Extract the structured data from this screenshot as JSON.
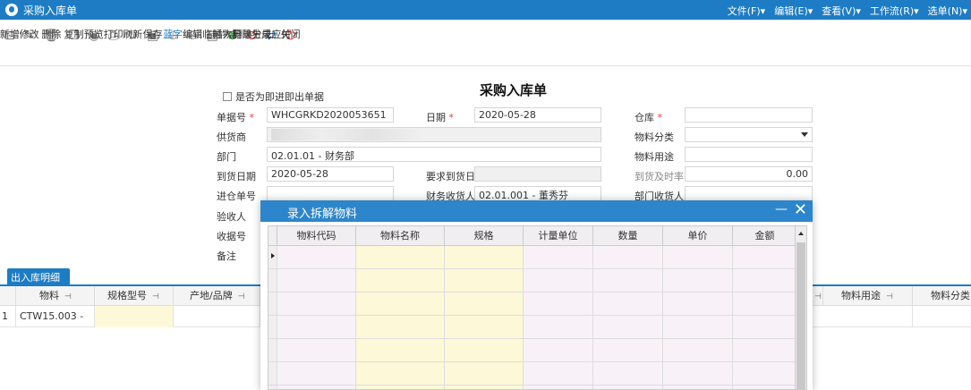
{
  "titlebar": {
    "title": "采购入库单"
  },
  "menus": [
    "文件(F)▾",
    "编辑(E)▾",
    "查看(V)▾",
    "工作流(R)▾",
    "选单(N)▾"
  ],
  "toolbar": [
    {
      "icon": "new-doc-icon",
      "glyph": "⊡",
      "label": "新增"
    },
    {
      "icon": "edit-icon",
      "glyph": "✎",
      "label": "修改"
    },
    {
      "icon": "trash-icon",
      "glyph": "🗑",
      "label": "删除"
    },
    {
      "icon": "copy-icon",
      "glyph": "❐",
      "label": "复制"
    },
    {
      "icon": "eye-icon",
      "glyph": "◉",
      "label": "预览"
    },
    {
      "icon": "printer-icon",
      "glyph": "⎙",
      "label": "打印"
    },
    {
      "icon": "refresh-icon",
      "glyph": "↻",
      "label": "刷新"
    },
    {
      "icon": "save-icon",
      "glyph": "▣",
      "label": "保存"
    },
    {
      "icon": "plus-circle-icon",
      "glyph": "⊕",
      "label": "蓝字"
    },
    {
      "icon": "minus-circle-icon",
      "glyph": "⊖",
      "label": "红字"
    },
    {
      "icon": "edit-list-icon",
      "glyph": "▤",
      "label": "编辑临时物料"
    },
    {
      "icon": "plus-circle-green-icon",
      "glyph": "⊕",
      "label": "插入分录"
    },
    {
      "icon": "minus-circle-red-icon",
      "glyph": "⊖",
      "label": "删除分录"
    },
    {
      "icon": "exchange-icon",
      "glyph": "⇄",
      "label": "生成应付"
    },
    {
      "icon": "power-icon",
      "glyph": "⏻",
      "label": "关闭"
    }
  ],
  "form": {
    "title": "采购入库单",
    "checkbox_label": "是否为即进即出单据",
    "bill_no_label": "单据号",
    "bill_no": "WHCGRKD2020053651",
    "date_label": "日期",
    "date": "2020-05-28",
    "warehouse_label": "仓库",
    "warehouse": "",
    "supplier_label": "供货商",
    "material_class_label": "物料分类",
    "material_class": "",
    "dept_label": "部门",
    "dept": "02.01.01 - 财务部",
    "material_use_label": "物料用途",
    "material_use": "",
    "arrival_date_label": "到货日期",
    "arrival_date": "2020-05-28",
    "req_arrival_label": "要求到货日期",
    "ontime_rate_label": "到货及时率(%)",
    "ontime_rate": "0.00",
    "in_no_label": "进仓单号",
    "in_no": "",
    "finance_receiver_label": "财务收货人",
    "finance_receiver": "02.01.001 - 董秀芬",
    "dept_receiver_label": "部门收货人",
    "dept_receiver": "",
    "inspector_label": "验收人",
    "receipt_no_label": "收据号",
    "remark_label": "备注"
  },
  "detail": {
    "tab_label": "出入库明细",
    "columns": [
      "物料",
      "规格型号",
      "产地/品牌"
    ],
    "right_columns": [
      "物料用途",
      "物料分类"
    ],
    "rows": [
      {
        "index": "1",
        "material": "CTW15.003 -"
      }
    ]
  },
  "modal": {
    "title": "录入拆解物料",
    "min_glyph": "—",
    "close_glyph": "✕",
    "columns": [
      "物料代码",
      "物料名称",
      "规格",
      "计量单位",
      "数量",
      "单价",
      "金额"
    ]
  }
}
